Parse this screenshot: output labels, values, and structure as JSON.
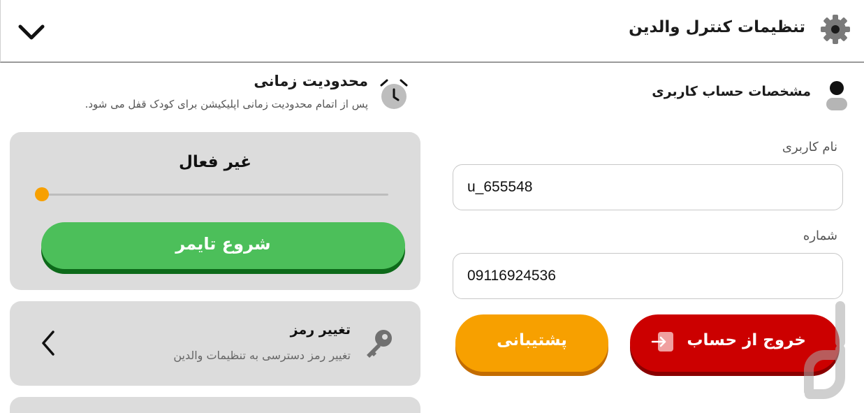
{
  "header": {
    "title": "تنظیمات کنترل والدین"
  },
  "account": {
    "title": "مشخصات حساب کاربری",
    "username_label": "نام کاربری",
    "username_value": "u_655548",
    "phone_label": "شماره",
    "phone_value": "09116924536",
    "logout_label": "خروج از حساب",
    "support_label": "پشتیبانی"
  },
  "time_limit": {
    "title": "محدودیت زمانی",
    "description": "پس از اتمام محدودیت زمانی اپلیکیشن برای کودک قفل می شود.",
    "status": "غیر فعال",
    "slider_value": 0,
    "start_button_label": "شروع تایمر"
  },
  "change_password": {
    "title": "تغییر رمز",
    "description": "تغییر رمز دسترسی به تنظیمات والدین"
  },
  "colors": {
    "accent_orange": "#f7a000",
    "danger_red": "#cc0000",
    "success_green": "#4cbf5a",
    "card_gray": "#dcdcdc"
  },
  "icons": [
    "gear-icon",
    "chevron-down-icon",
    "user-icon",
    "alarm-clock-icon",
    "key-icon",
    "chevron-left-icon",
    "exit-icon"
  ]
}
